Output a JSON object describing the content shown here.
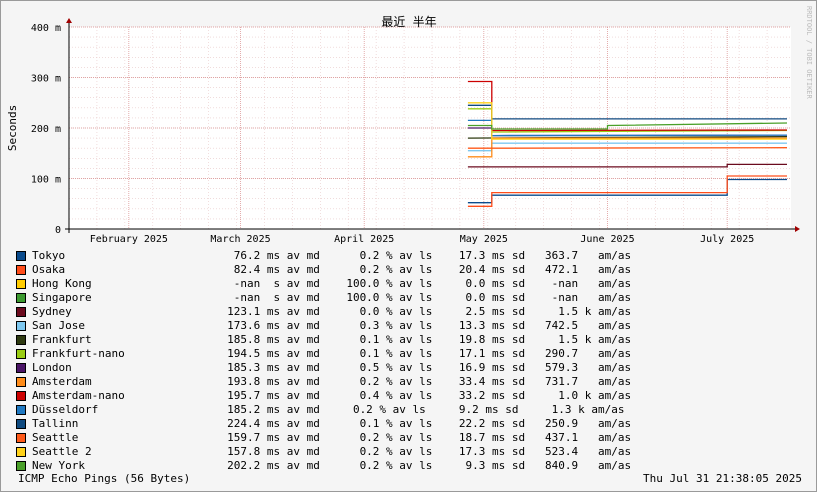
{
  "chart_data": {
    "type": "line",
    "title": "最近 半年",
    "ylabel": "Seconds",
    "watermark": "RRDTOOL / TOBI OETIKER",
    "ylim": [
      0,
      0.4
    ],
    "y_ticks": [
      {
        "value": 0,
        "label": "0"
      },
      {
        "value": 0.1,
        "label": "100 m"
      },
      {
        "value": 0.2,
        "label": "200 m"
      },
      {
        "value": 0.3,
        "label": "300 m"
      },
      {
        "value": 0.4,
        "label": "400 m"
      }
    ],
    "x_range": [
      "2025-01-31",
      "2025-07-31"
    ],
    "x_ticks": [
      {
        "date": "2025-02-15",
        "label": "February 2025"
      },
      {
        "date": "2025-03-15",
        "label": "March 2025"
      },
      {
        "date": "2025-04-15",
        "label": "April 2025"
      },
      {
        "date": "2025-05-15",
        "label": "May 2025"
      },
      {
        "date": "2025-06-15",
        "label": "June 2025"
      },
      {
        "date": "2025-07-15",
        "label": "July 2025"
      }
    ],
    "grid": true,
    "series": [
      {
        "name": "Tokyo",
        "color": "#0a4b8c",
        "points": [
          [
            "2025-05-11",
            0.052
          ],
          [
            "2025-05-17",
            0.052
          ],
          [
            "2025-05-17",
            0.067
          ],
          [
            "2025-07-15",
            0.067
          ],
          [
            "2025-07-15",
            0.098
          ],
          [
            "2025-07-30",
            0.098
          ]
        ],
        "legend": "76.2 ms av md      0.2 % av ls    17.3 ms sd   363.7   am/as"
      },
      {
        "name": "Osaka",
        "color": "#ff4d1a",
        "points": [
          [
            "2025-05-11",
            0.045
          ],
          [
            "2025-05-17",
            0.045
          ],
          [
            "2025-05-17",
            0.072
          ],
          [
            "2025-07-15",
            0.072
          ],
          [
            "2025-07-15",
            0.105
          ],
          [
            "2025-07-30",
            0.105
          ]
        ],
        "legend": "82.4 ms av md      0.2 % av ls    20.4 ms sd   472.1   am/as"
      },
      {
        "name": "Hong Kong",
        "color": "#ffcc00",
        "points": [],
        "legend": "-nan  s av md    100.0 % av ls     0.0 ms sd    -nan   am/as"
      },
      {
        "name": "Singapore",
        "color": "#3c9a2f",
        "points": [],
        "legend": "-nan  s av md    100.0 % av ls     0.0 ms sd    -nan   am/as"
      },
      {
        "name": "Sydney",
        "color": "#6b0a1e",
        "points": [
          [
            "2025-05-11",
            0.123
          ],
          [
            "2025-07-15",
            0.123
          ],
          [
            "2025-07-15",
            0.128
          ],
          [
            "2025-07-30",
            0.128
          ]
        ],
        "legend": "123.1 ms av md      0.0 % av ls     2.5 ms sd     1.5 k am/as"
      },
      {
        "name": "San Jose",
        "color": "#7ec8f0",
        "points": [
          [
            "2025-05-11",
            0.155
          ],
          [
            "2025-05-17",
            0.155
          ],
          [
            "2025-05-17",
            0.17
          ],
          [
            "2025-07-30",
            0.17
          ]
        ],
        "legend": "173.6 ms av md      0.3 % av ls    13.3 ms sd   742.5   am/as"
      },
      {
        "name": "Frankfurt",
        "color": "#2e3a10",
        "points": [
          [
            "2025-05-11",
            0.18
          ],
          [
            "2025-07-30",
            0.183
          ]
        ],
        "legend": "185.8 ms av md      0.1 % av ls    19.8 ms sd     1.5 k am/as"
      },
      {
        "name": "Frankfurt-nano",
        "color": "#9acd14",
        "points": [
          [
            "2025-05-11",
            0.238
          ],
          [
            "2025-05-17",
            0.238
          ],
          [
            "2025-05-17",
            0.192
          ],
          [
            "2025-07-30",
            0.195
          ]
        ],
        "legend": "194.5 ms av md      0.1 % av ls    17.1 ms sd   290.7   am/as"
      },
      {
        "name": "London",
        "color": "#4a1466",
        "points": [
          [
            "2025-05-11",
            0.2
          ],
          [
            "2025-05-17",
            0.2
          ],
          [
            "2025-05-17",
            0.185
          ],
          [
            "2025-07-30",
            0.186
          ]
        ],
        "legend": "185.3 ms av md      0.5 % av ls    16.9 ms sd   579.3   am/as"
      },
      {
        "name": "Amsterdam",
        "color": "#ff8c1a",
        "points": [
          [
            "2025-05-11",
            0.143
          ],
          [
            "2025-05-17",
            0.143
          ],
          [
            "2025-05-17",
            0.18
          ],
          [
            "2025-07-30",
            0.18
          ]
        ],
        "legend": "193.8 ms av md      0.2 % av ls    33.4 ms sd   731.7   am/as"
      },
      {
        "name": "Amsterdam-nano",
        "color": "#cc0000",
        "points": [
          [
            "2025-05-11",
            0.292
          ],
          [
            "2025-05-17",
            0.292
          ],
          [
            "2025-05-17",
            0.195
          ],
          [
            "2025-07-30",
            0.196
          ]
        ],
        "legend": "195.7 ms av md      0.4 % av ls    33.2 ms sd     1.0 k am/as"
      },
      {
        "name": "Düsseldorf",
        "color": "#1f78c1",
        "points": [
          [
            "2025-05-11",
            0.215
          ],
          [
            "2025-05-17",
            0.215
          ],
          [
            "2025-05-17",
            0.185
          ],
          [
            "2025-07-30",
            0.186
          ]
        ],
        "legend": "185.2 ms av md     0.2 % av ls     9.2 ms sd     1.3 k am/as"
      },
      {
        "name": "Tallinn",
        "color": "#0f4a80",
        "points": [
          [
            "2025-05-11",
            0.245
          ],
          [
            "2025-05-17",
            0.245
          ],
          [
            "2025-05-17",
            0.218
          ],
          [
            "2025-07-30",
            0.218
          ]
        ],
        "legend": "224.4 ms av md      0.1 % av ls    22.2 ms sd   250.9   am/as"
      },
      {
        "name": "Seattle",
        "color": "#ff5a1a",
        "points": [
          [
            "2025-05-11",
            0.16
          ],
          [
            "2025-05-17",
            0.16
          ],
          [
            "2025-05-17",
            0.16
          ],
          [
            "2025-07-30",
            0.161
          ]
        ],
        "legend": "159.7 ms av md      0.2 % av ls    18.7 ms sd   437.1   am/as"
      },
      {
        "name": "Seattle 2",
        "color": "#ffd21a",
        "points": [
          [
            "2025-05-11",
            0.25
          ],
          [
            "2025-05-17",
            0.25
          ],
          [
            "2025-05-17",
            0.178
          ],
          [
            "2025-07-30",
            0.178
          ]
        ],
        "legend": "157.8 ms av md      0.2 % av ls    17.3 ms sd   523.4   am/as"
      },
      {
        "name": "New York",
        "color": "#4aa02a",
        "points": [
          [
            "2025-05-11",
            0.205
          ],
          [
            "2025-05-17",
            0.205
          ],
          [
            "2025-05-17",
            0.198
          ],
          [
            "2025-06-15",
            0.198
          ],
          [
            "2025-06-15",
            0.205
          ],
          [
            "2025-07-30",
            0.21
          ]
        ],
        "legend": "202.2 ms av md      0.2 % av ls     9.3 ms sd   840.9   am/as"
      }
    ]
  },
  "footer": {
    "left": "ICMP Echo Pings (56 Bytes)",
    "right": "Thu Jul 31 21:38:05 2025"
  }
}
